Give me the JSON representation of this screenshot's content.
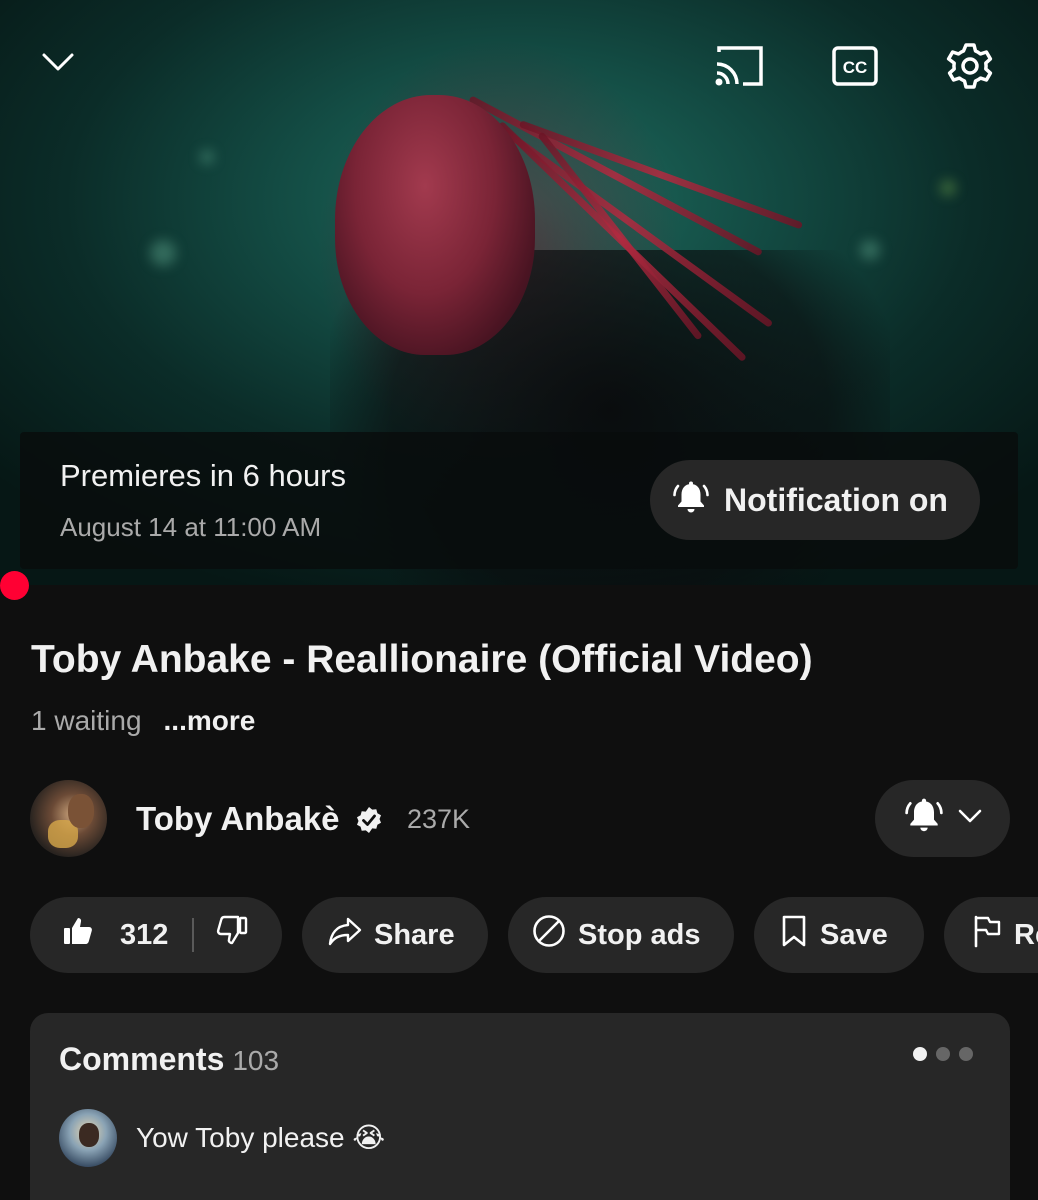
{
  "player": {
    "icons": {
      "minimize": "chevron-down-icon",
      "cast": "cast-icon",
      "captions": "closed-captions-icon",
      "settings": "gear-icon"
    },
    "captions_label": "CC",
    "premiere": {
      "title": "Premieres in 6 hours",
      "date": "August 14 at 11:00 AM",
      "notify_label": "Notification on",
      "notify_icon": "bell-ringing-icon"
    },
    "progress_color": "#ff0033"
  },
  "video": {
    "title": "Toby Anbake - Reallionaire (Official Video)",
    "waiting": "1 waiting",
    "more": "...more"
  },
  "channel": {
    "name": "Toby Anbakè",
    "subscribers": "237K",
    "verified_icon": "verified-badge-icon",
    "bell_icon": "bell-ringing-icon",
    "dropdown_icon": "chevron-down-icon"
  },
  "actions": {
    "like_count": "312",
    "share_label": "Share",
    "stop_ads_label": "Stop ads",
    "save_label": "Save",
    "report_label": "Re"
  },
  "comments": {
    "title": "Comments",
    "count": "103",
    "pages": 3,
    "active_page": 1,
    "top_comment": {
      "text": "Yow Toby please 😭"
    }
  },
  "colors": {
    "background": "#0f0f0f",
    "surface": "#272727",
    "text_primary": "#f1f1f1",
    "text_secondary": "#aaaaaa",
    "accent_red": "#ff0033"
  }
}
